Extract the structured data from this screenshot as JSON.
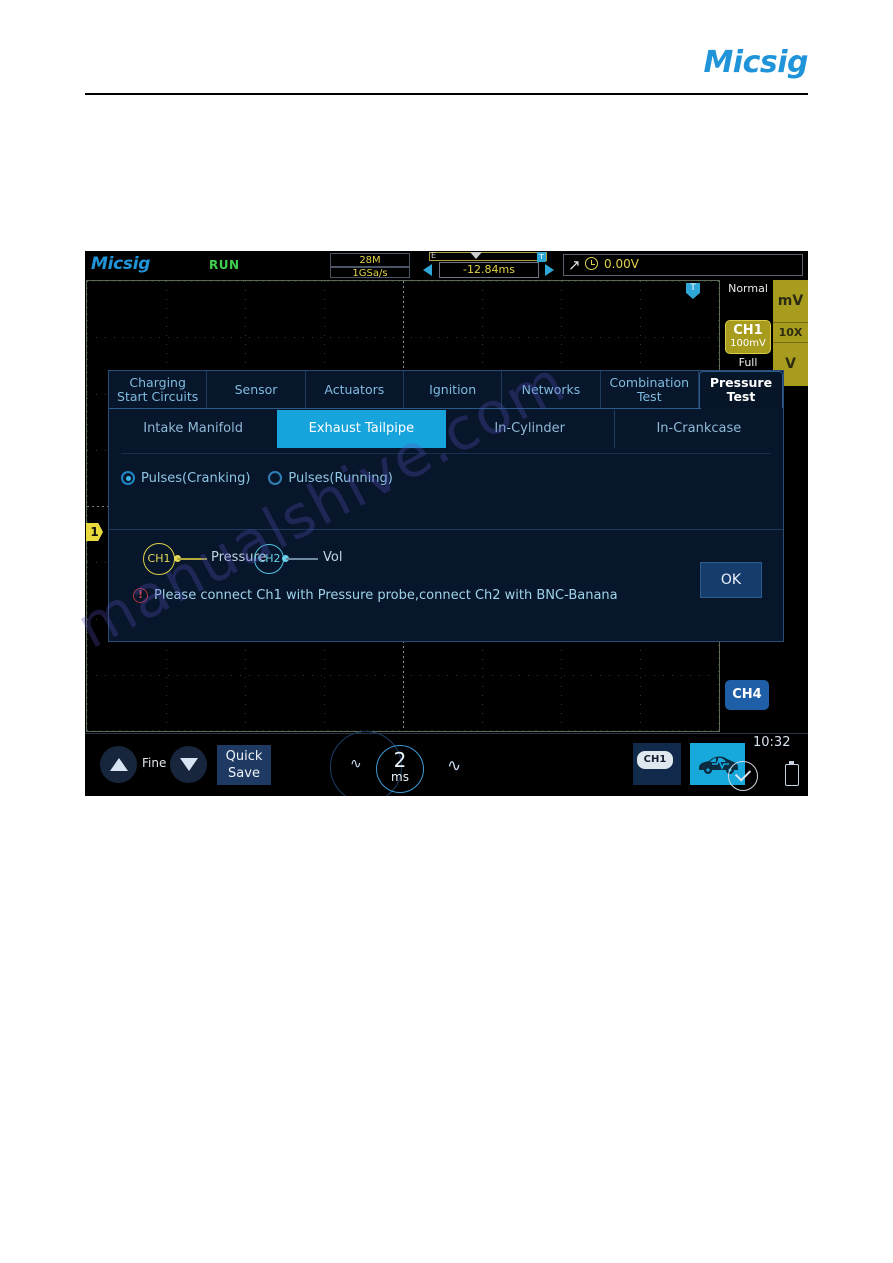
{
  "document": {
    "brand": "Micsig"
  },
  "watermark": {
    "line1": "manualshive.com"
  },
  "scope": {
    "brand": "Micsig",
    "run_state": "RUN",
    "acquisition": {
      "memory_depth": "28M",
      "sample_rate": "1GSa/s"
    },
    "time_position": {
      "value": "-12.84ms",
      "overview_label": "E",
      "overview_marker": "T",
      "left_arrow_icon": "triangle-left-icon",
      "right_arrow_icon": "triangle-right-icon"
    },
    "trigger": {
      "slope_icon": "rising-edge-icon",
      "source_icon": "trigger-info-icon",
      "level": "0.00V",
      "mode": "Normal",
      "flag": "T"
    },
    "channel1": {
      "marker": "1",
      "badge_label": "CH1",
      "badge_coupling": "═",
      "badge_scale": "100mV",
      "bandwidth": "Full"
    },
    "channel4": {
      "label": "CH4"
    },
    "vertical_keys": {
      "mv": "mV",
      "probe": "10X",
      "v": "V"
    },
    "toolbar": {
      "up_icon": "triangle-up-icon",
      "fine_label": "Fine",
      "down_icon": "triangle-down-icon",
      "quick_save": "Quick\nSave",
      "quick_save_line1": "Quick",
      "quick_save_line2": "Save",
      "timebase_value": "2",
      "timebase_unit": "ms",
      "wave_small_icon": "waveform-small-icon",
      "wave_large_icon": "waveform-large-icon",
      "ch1_stack_label": "CH1",
      "car_icon": "automotive-car-icon",
      "clock": "10:32",
      "chevron_icon": "chevron-down-icon",
      "battery_icon": "battery-icon"
    }
  },
  "dialog": {
    "category_tabs": [
      {
        "label": "Charging\nStart Circuits",
        "line1": "Charging",
        "line2": "Start Circuits",
        "active": false
      },
      {
        "label": "Sensor",
        "line1": "Sensor",
        "line2": "",
        "active": false
      },
      {
        "label": "Actuators",
        "line1": "Actuators",
        "line2": "",
        "active": false
      },
      {
        "label": "Ignition",
        "line1": "Ignition",
        "line2": "",
        "active": false
      },
      {
        "label": "Networks",
        "line1": "Networks",
        "line2": "",
        "active": false
      },
      {
        "label": "Combination\nTest",
        "line1": "Combination",
        "line2": "Test",
        "active": false
      },
      {
        "label": "Pressure\nTest",
        "line1": "Pressure",
        "line2": "Test",
        "active": true
      }
    ],
    "sub_tabs": [
      {
        "label": "Intake Manifold",
        "active": false
      },
      {
        "label": "Exhaust Tailpipe",
        "active": true
      },
      {
        "label": "In-Cylinder",
        "active": false
      },
      {
        "label": "In-Crankcase",
        "active": false
      }
    ],
    "radio_options": [
      {
        "label": "Pulses(Cranking)",
        "selected": true
      },
      {
        "label": "Pulses(Running)",
        "selected": false
      }
    ],
    "probe_diagram": {
      "node1": "CH1",
      "node1_label": "Pressure",
      "node2": "CH2",
      "node2_label": "Vol"
    },
    "warning": {
      "icon": "warning-exclamation-icon",
      "text": "Please connect Ch1 with Pressure probe,connect Ch2 with BNC-Banana"
    },
    "ok_button": "OK"
  },
  "colors": {
    "brand_blue": "#1f94d9",
    "accent_cyan": "#17a4dd",
    "channel1_yellow": "#e3da58",
    "channel2_cyan": "#68d2ea",
    "warning_red": "#c84a50",
    "run_green": "#3ecf4e"
  }
}
